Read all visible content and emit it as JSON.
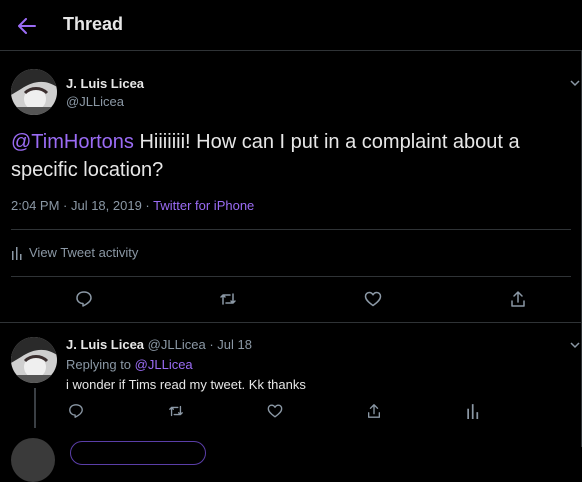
{
  "header": {
    "title": "Thread"
  },
  "main_tweet": {
    "author_name": "J. Luis Licea",
    "author_handle": "@JLLicea",
    "mention": "@TimHortons",
    "text": " Hiiiiiii! How can I put in a complaint about a specific location?",
    "time": "2:04 PM · Jul 18, 2019 · ",
    "source": "Twitter for iPhone",
    "activity_label": "View Tweet activity"
  },
  "reply_tweet": {
    "author_name": "J. Luis Licea",
    "author_handle": "@JLLicea",
    "date": "· Jul 18",
    "replying_label": "Replying to ",
    "replying_to": "@JLLicea",
    "text": "i wonder if Tims read my tweet. Kk thanks"
  },
  "colors": {
    "accent": "#9b6cf5",
    "background": "#000000",
    "muted": "#8b98a5",
    "divider": "#2f3336"
  },
  "icons": [
    "back-arrow-icon",
    "chevron-down-icon",
    "reply-icon",
    "retweet-icon",
    "like-icon",
    "share-icon",
    "analytics-icon"
  ]
}
